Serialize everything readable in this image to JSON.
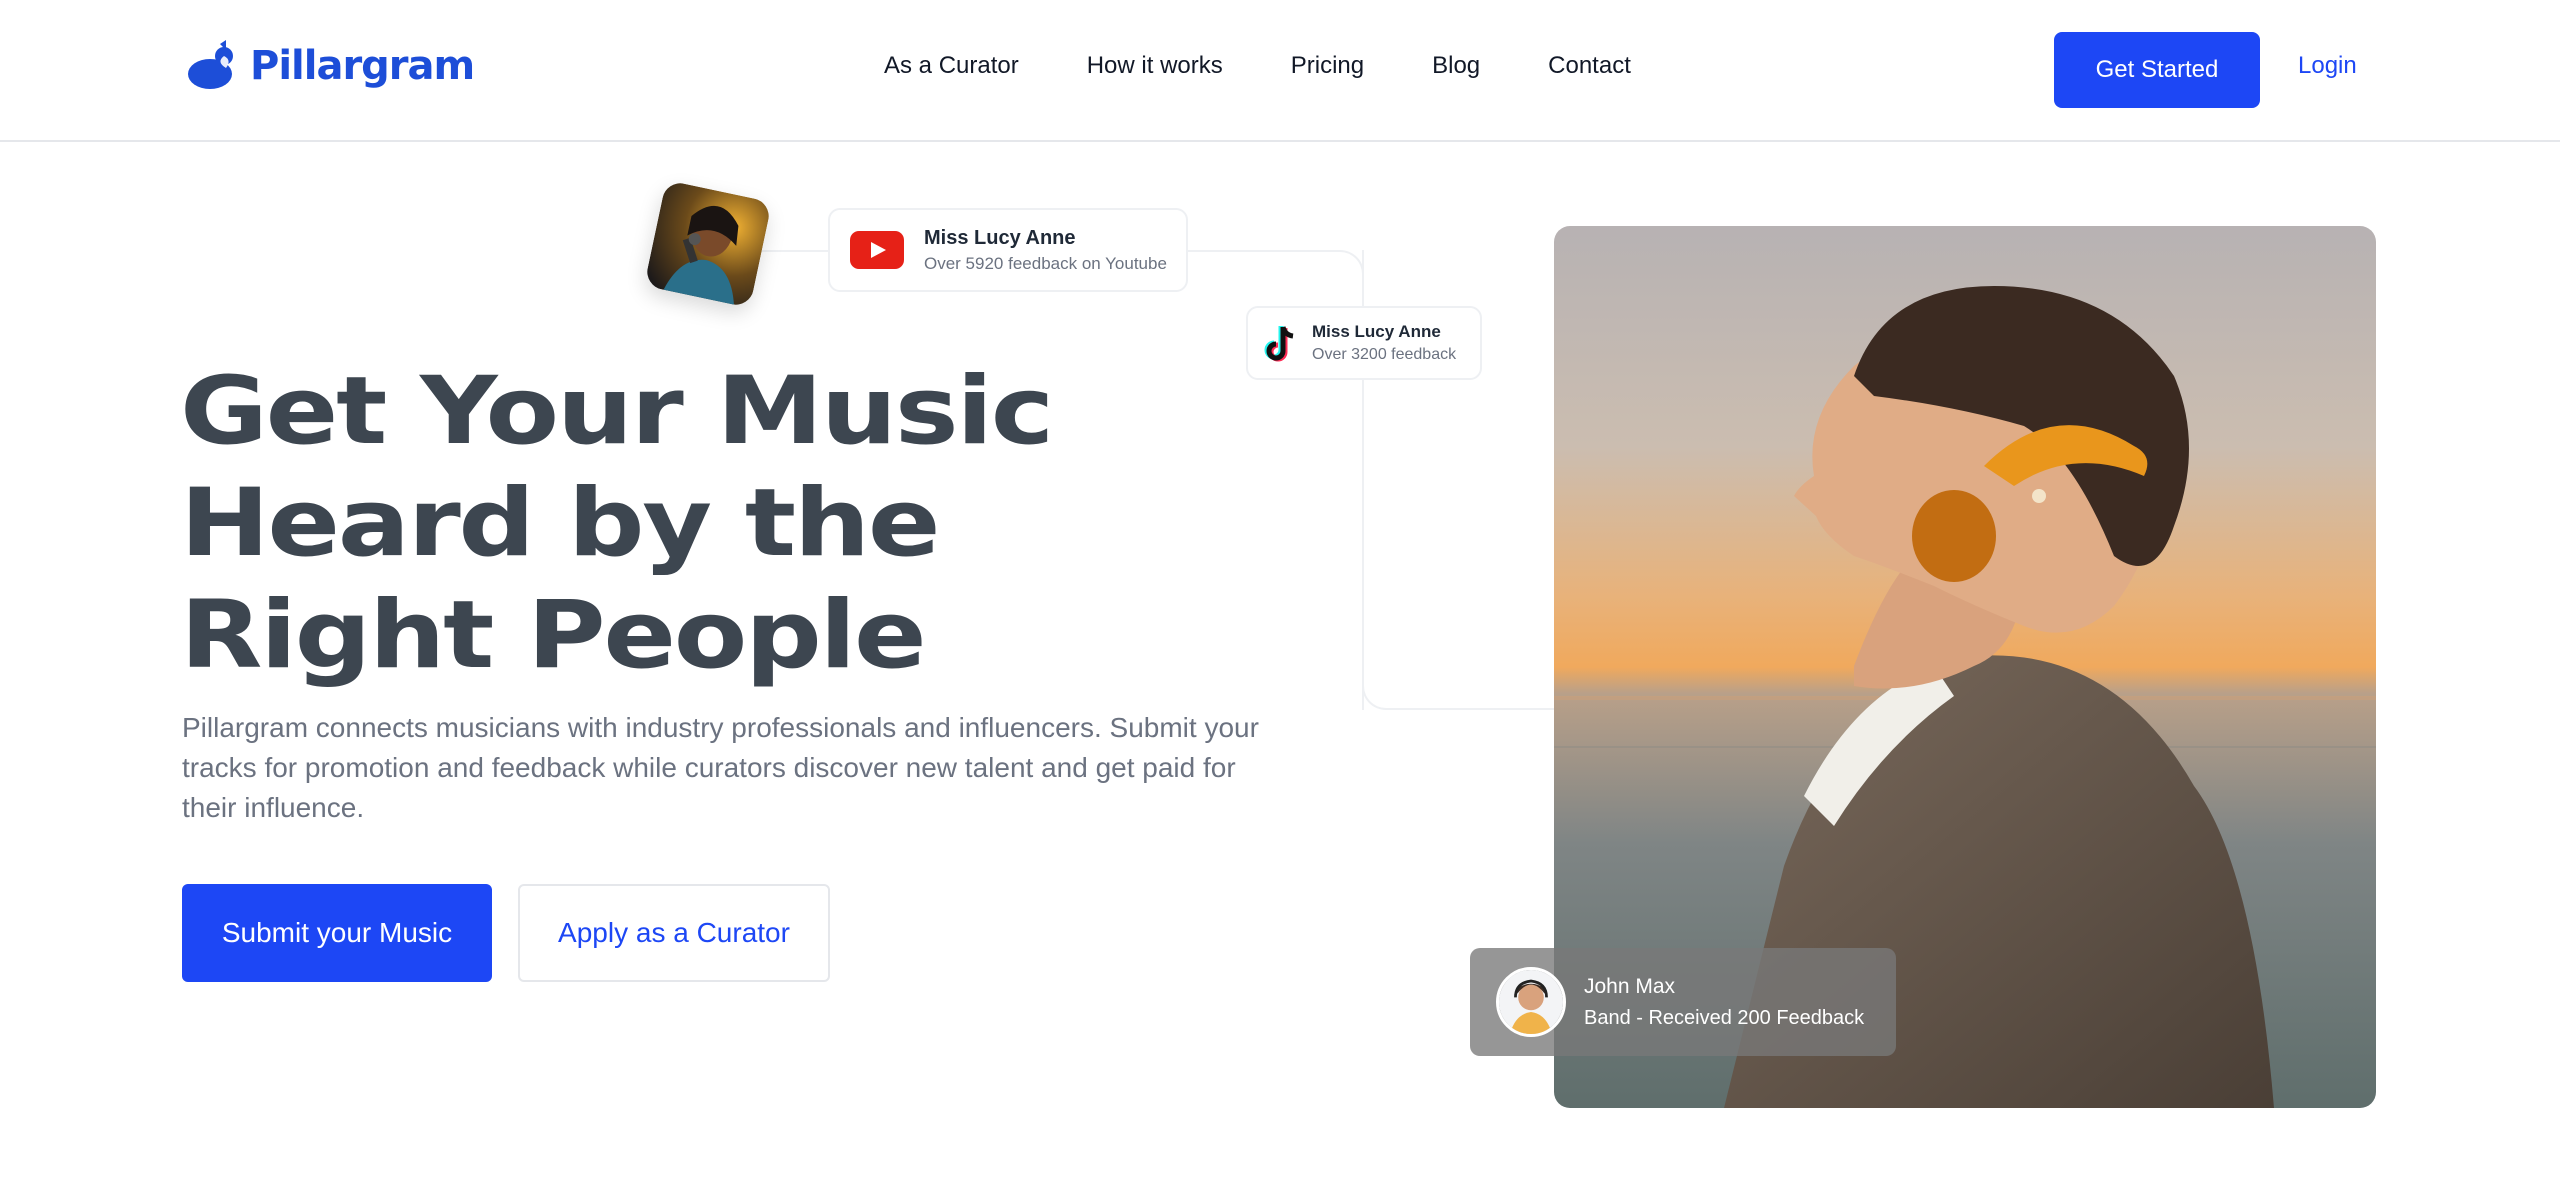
{
  "brand": {
    "name": "Pillargram",
    "color": "#1d4ed8"
  },
  "nav": {
    "items": [
      "As a Curator",
      "How it works",
      "Pricing",
      "Blog",
      "Contact"
    ]
  },
  "header": {
    "cta_label": "Get Started",
    "login_label": "Login"
  },
  "hero": {
    "title_lines": [
      "Get Your Music",
      "Heard by the",
      "Right People"
    ],
    "description": "Pillargram connects musicians with industry professionals and influencers. Submit your tracks for promotion and feedback while curators discover new talent and get paid for their influence.",
    "primary_cta": "Submit your Music",
    "secondary_cta": "Apply as a Curator"
  },
  "cards": {
    "youtube": {
      "name": "Miss Lucy Anne",
      "subtitle": "Over 5920 feedback on Youtube",
      "icon": "youtube-icon"
    },
    "tiktok": {
      "name": "Miss Lucy Anne",
      "subtitle": "Over 3200 feedback",
      "icon": "tiktok-icon"
    }
  },
  "review": {
    "name": "John Max",
    "subtitle": "Band - Received 200 Feedback"
  },
  "colors": {
    "accent": "#1d47f5",
    "heading": "#3d4650",
    "muted": "#6b7280"
  }
}
